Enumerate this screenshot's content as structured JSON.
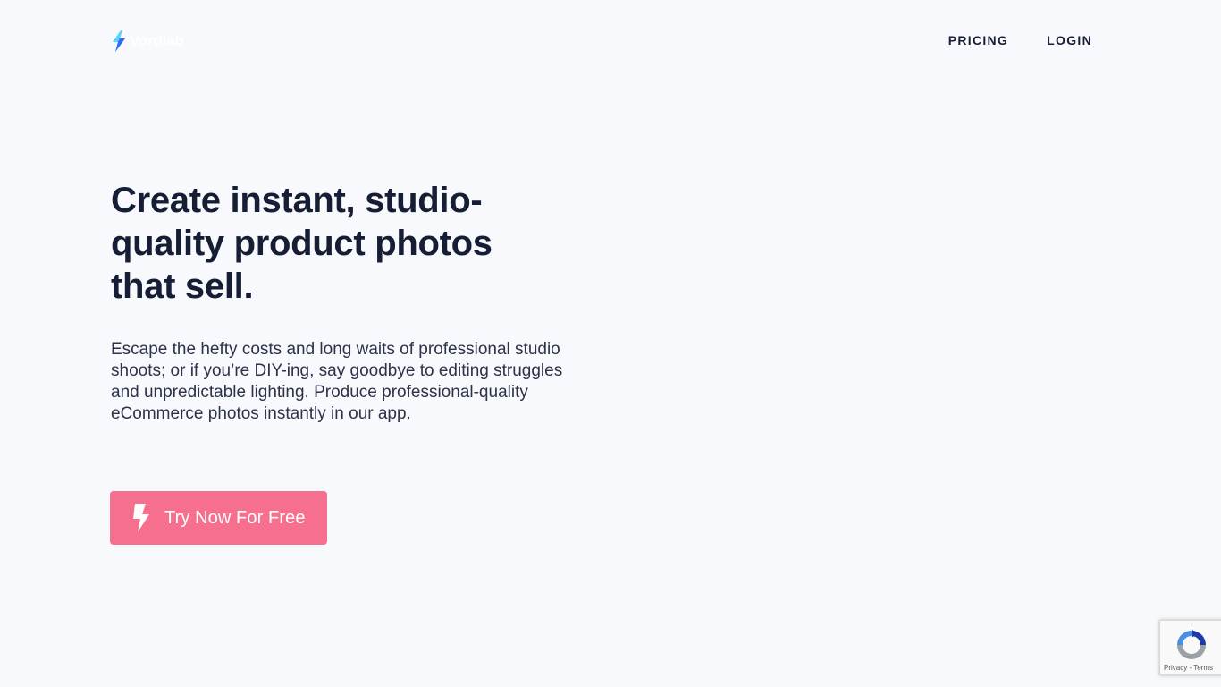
{
  "header": {
    "logo_text": "Vordlab",
    "nav": {
      "pricing": "PRICING",
      "login": "LOGIN"
    }
  },
  "hero": {
    "headline": "Create instant, studio-quality product photos that sell.",
    "subtext": "Escape the hefty costs and long waits of professional studio shoots; or if you’re DIY-ing, say goodbye to editing struggles and unpredictable lighting. Produce professional-quality eCommerce photos instantly in our app.",
    "cta_label": "Try Now For Free"
  },
  "recaptcha": {
    "privacy": "Privacy",
    "separator": " - ",
    "terms": "Terms"
  },
  "icons": {
    "logo": "lightning-bolt-icon",
    "cta": "lightning-bolt-icon",
    "recaptcha": "recaptcha-icon"
  },
  "colors": {
    "background": "#f8f9fc",
    "text_dark": "#161e35",
    "cta_background": "#f76f8e",
    "logo_bolt_light": "#5ad1ff",
    "logo_bolt_dark": "#2b6cf6"
  }
}
